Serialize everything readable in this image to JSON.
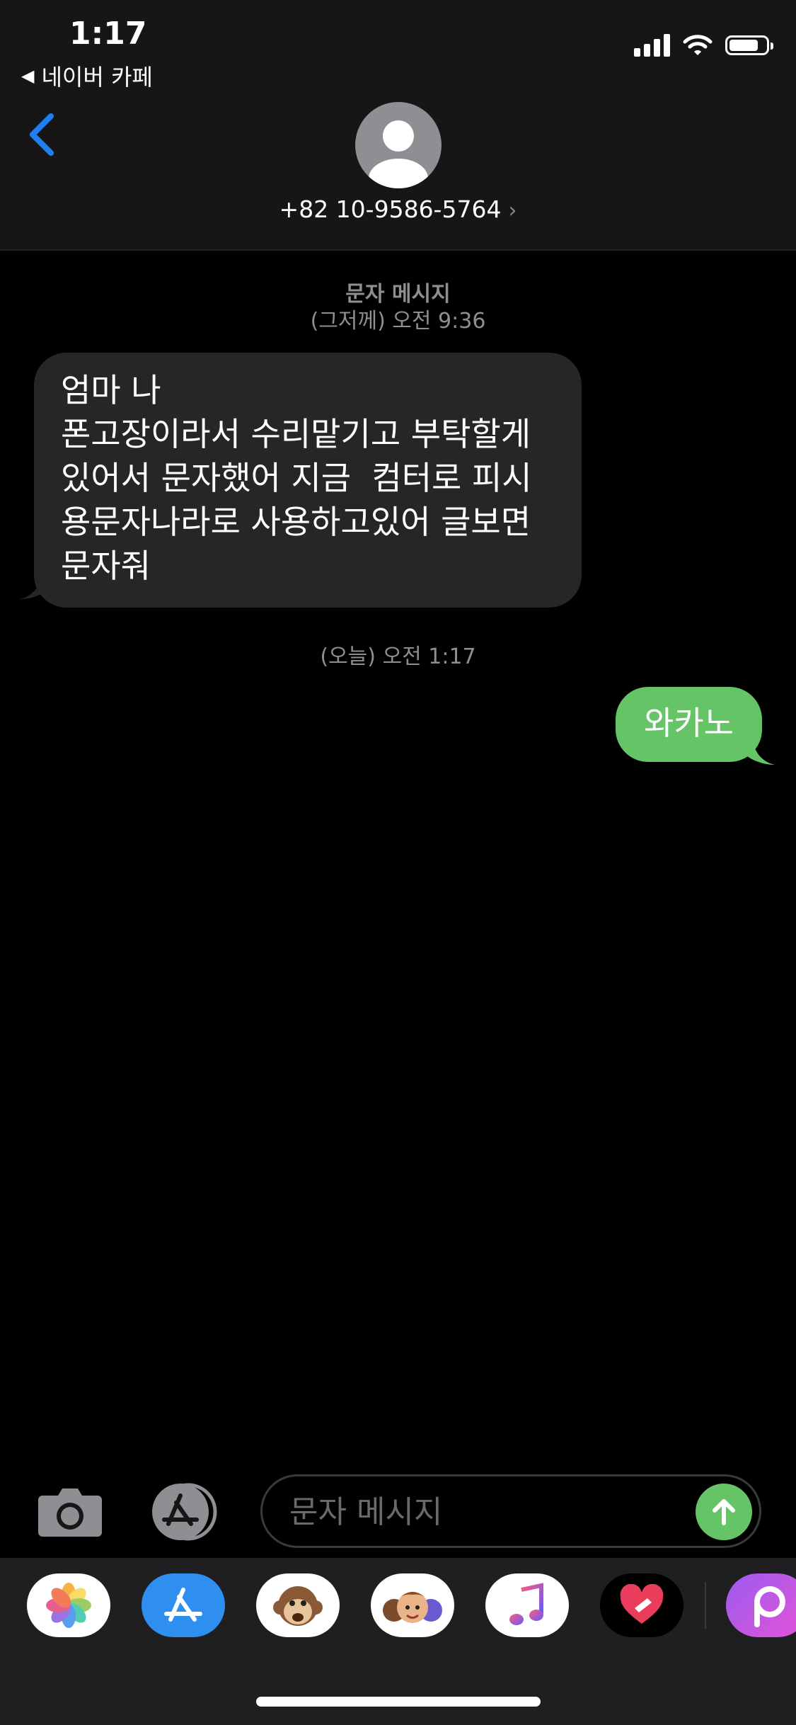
{
  "status_bar": {
    "time": "1:17",
    "back_app": "네이버 카페"
  },
  "header": {
    "contact": "+82 10-9586-5764"
  },
  "thread": {
    "meta1_line1": "문자 메시지",
    "meta1_line2": "(그저께) 오전 9:36",
    "incoming": "엄마 나\n폰고장이라서 수리맡기고 부탁할게\n있어서 문자했어 지금  컴터로 피시\n용문자나라로 사용하고있어 글보면\n문자줘",
    "meta2": "(오늘) 오전 1:17",
    "outgoing": "와카노"
  },
  "compose": {
    "placeholder": "문자 메시지"
  },
  "drawer": {
    "apps": [
      "photos-icon",
      "app-store-icon",
      "animoji-icon",
      "memoji-icon",
      "music-icon",
      "digital-touch-icon",
      "picsart-icon"
    ]
  },
  "colors": {
    "incoming_bubble": "#262628",
    "outgoing_bubble": "#65c466",
    "accent_blue": "#1f7ff2",
    "header_bg": "#161616"
  }
}
